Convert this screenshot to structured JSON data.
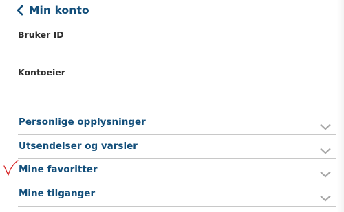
{
  "header": {
    "back_label": "Min konto",
    "back_icon": "chevron-left-icon",
    "accent_color": "#124e7a"
  },
  "fields": {
    "user_id_label": "Bruker ID",
    "owner_label": "Kontoeier"
  },
  "sections": [
    {
      "label": "Personlige opplysninger",
      "icon": "chevron-down-icon"
    },
    {
      "label": "Utsendelser og varsler",
      "icon": "chevron-down-icon"
    },
    {
      "label": "Mine favoritter",
      "icon": "chevron-down-icon"
    },
    {
      "label": "Mine tilganger",
      "icon": "chevron-down-icon"
    }
  ],
  "annotation": {
    "icon": "red-checkmark",
    "color": "#d62020"
  }
}
